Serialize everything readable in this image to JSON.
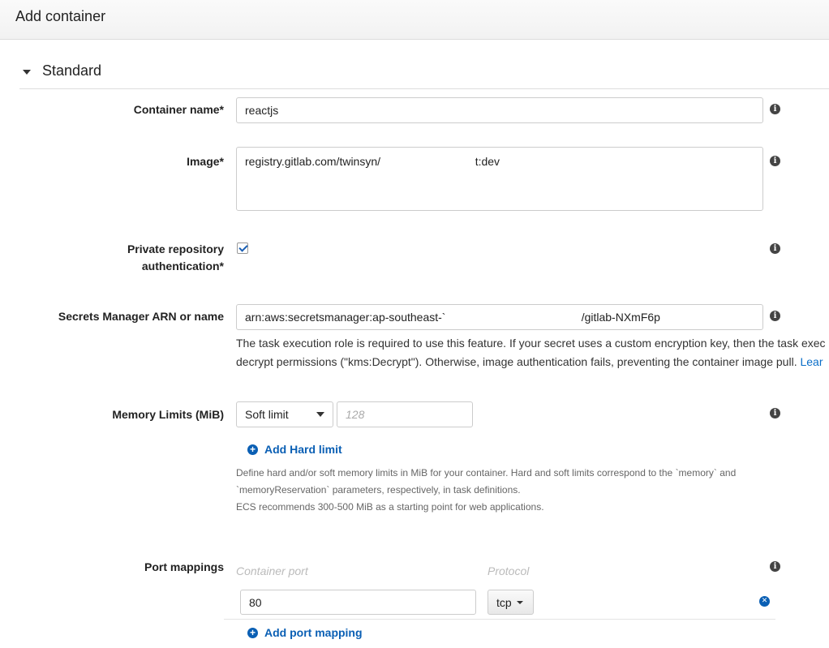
{
  "header": {
    "title": "Add container"
  },
  "section": {
    "title": "Standard"
  },
  "fields": {
    "container_name": {
      "label": "Container name*",
      "value": "reactjs"
    },
    "image": {
      "label": "Image*",
      "value": "registry.gitlab.com/twinsyn/                              t:dev"
    },
    "private_repo": {
      "label_line1": "Private repository",
      "label_line2": "authentication*",
      "checked": true
    },
    "secrets": {
      "label": "Secrets Manager ARN or name",
      "value": "arn:aws:secretsmanager:ap-southeast-`                                           /gitlab-NXmF6p",
      "help_line1": "The task execution role is required to use this feature. If your secret uses a custom encryption key, then the task exec",
      "help_line2": "decrypt permissions (\"kms:Decrypt\"). Otherwise, image authentication fails, preventing the container image pull. ",
      "help_link": "Lear"
    },
    "memory": {
      "label": "Memory Limits (MiB)",
      "select_value": "Soft limit",
      "placeholder": "128",
      "add_label": "Add Hard limit",
      "help_line1": "Define hard and/or soft memory limits in MiB for your container. Hard and soft limits correspond to the `memory` and",
      "help_line2": "`memoryReservation` parameters, respectively, in task definitions.",
      "help_line3": "ECS recommends 300-500 MiB as a starting point for web applications."
    },
    "ports": {
      "label": "Port mappings",
      "col_container": "Container port",
      "col_protocol": "Protocol",
      "rows": [
        {
          "port": "80",
          "protocol": "tcp"
        }
      ],
      "add_label": "Add port mapping"
    }
  },
  "icons": {
    "info": "info-icon",
    "remove": "remove-circle-icon",
    "add": "plus-circle-icon"
  },
  "colors": {
    "link": "#0a5fb4"
  }
}
